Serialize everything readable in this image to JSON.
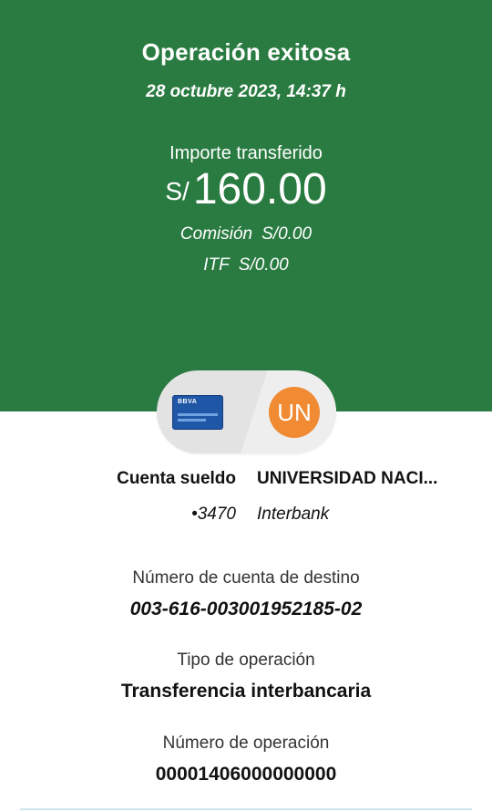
{
  "header": {
    "title": "Operación exitosa",
    "datetime": "28 octubre 2023, 14:37 h",
    "amount_label": "Importe transferido",
    "amount_currency": "S/",
    "amount_value": "160.00",
    "commission_label": "Comisión",
    "commission_value": "S/0.00",
    "itf_label": "ITF",
    "itf_value": "S/0.00"
  },
  "transfer": {
    "card_brand": "BBVA",
    "avatar_initials": "UN",
    "from_name": "Cuenta sueldo",
    "from_account": "•3470",
    "to_name": "UNIVERSIDAD NACI...",
    "to_bank": "Interbank"
  },
  "details": {
    "dest_account_label": "Número de cuenta de destino",
    "dest_account_value": "003-616-003001952185-02",
    "operation_type_label": "Tipo de operación",
    "operation_type_value": "Transferencia interbancaria",
    "operation_number_label": "Número de operación",
    "operation_number_value": "00001406000000000"
  },
  "colors": {
    "header_green": "#2a7b41",
    "avatar_orange": "#f08a33",
    "card_blue": "#1f56a6"
  }
}
